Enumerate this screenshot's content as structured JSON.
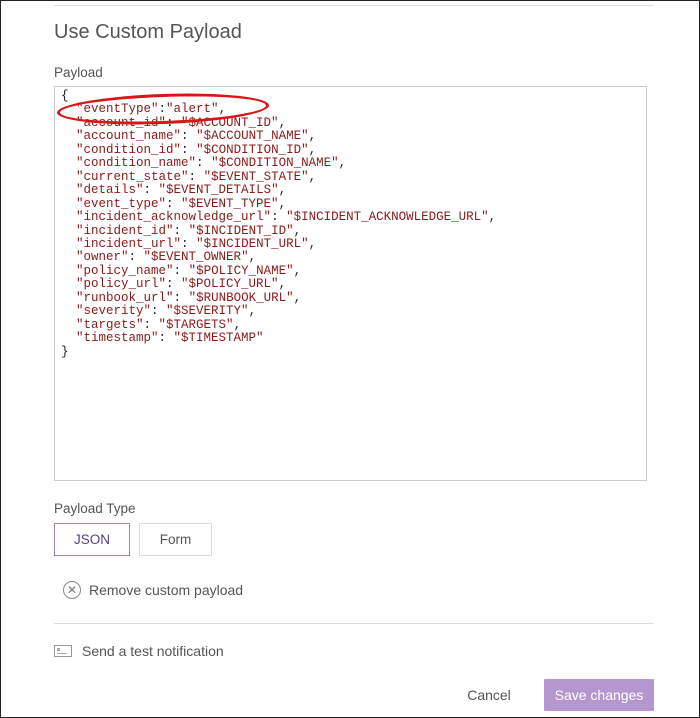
{
  "section": {
    "title": "Use Custom Payload"
  },
  "payload": {
    "label": "Payload",
    "open_brace": "{",
    "close_brace": "}",
    "entries": [
      {
        "key": "\"eventType\"",
        "sep": ":",
        "value": "\"alert\"",
        "comma": ","
      },
      {
        "key": "\"account_id\"",
        "sep": ": ",
        "value": "\"$ACCOUNT_ID\"",
        "comma": ","
      },
      {
        "key": "\"account_name\"",
        "sep": ": ",
        "value": "\"$ACCOUNT_NAME\"",
        "comma": ","
      },
      {
        "key": "\"condition_id\"",
        "sep": ": ",
        "value": "\"$CONDITION_ID\"",
        "comma": ","
      },
      {
        "key": "\"condition_name\"",
        "sep": ": ",
        "value": "\"$CONDITION_NAME\"",
        "comma": ","
      },
      {
        "key": "\"current_state\"",
        "sep": ": ",
        "value": "\"$EVENT_STATE\"",
        "comma": ","
      },
      {
        "key": "\"details\"",
        "sep": ": ",
        "value": "\"$EVENT_DETAILS\"",
        "comma": ","
      },
      {
        "key": "\"event_type\"",
        "sep": ": ",
        "value": "\"$EVENT_TYPE\"",
        "comma": ","
      },
      {
        "key": "\"incident_acknowledge_url\"",
        "sep": ": ",
        "value": "\"$INCIDENT_ACKNOWLEDGE_URL\"",
        "comma": ","
      },
      {
        "key": "\"incident_id\"",
        "sep": ": ",
        "value": "\"$INCIDENT_ID\"",
        "comma": ","
      },
      {
        "key": "\"incident_url\"",
        "sep": ": ",
        "value": "\"$INCIDENT_URL\"",
        "comma": ","
      },
      {
        "key": "\"owner\"",
        "sep": ": ",
        "value": "\"$EVENT_OWNER\"",
        "comma": ","
      },
      {
        "key": "\"policy_name\"",
        "sep": ": ",
        "value": "\"$POLICY_NAME\"",
        "comma": ","
      },
      {
        "key": "\"policy_url\"",
        "sep": ": ",
        "value": "\"$POLICY_URL\"",
        "comma": ","
      },
      {
        "key": "\"runbook_url\"",
        "sep": ": ",
        "value": "\"$RUNBOOK_URL\"",
        "comma": ","
      },
      {
        "key": "\"severity\"",
        "sep": ": ",
        "value": "\"$SEVERITY\"",
        "comma": ","
      },
      {
        "key": "\"targets\"",
        "sep": ": ",
        "value": "\"$TARGETS\"",
        "comma": ","
      },
      {
        "key": "\"timestamp\"",
        "sep": ": ",
        "value": "\"$TIMESTAMP\"",
        "comma": ""
      }
    ]
  },
  "payload_type": {
    "label": "Payload Type",
    "options": [
      "JSON",
      "Form"
    ],
    "selected": "JSON"
  },
  "remove_custom_payload": {
    "label": "Remove custom payload",
    "icon": "circle-x-icon"
  },
  "test_notification": {
    "label": "Send a test notification",
    "icon": "notification-card-icon"
  },
  "actions": {
    "cancel_label": "Cancel",
    "save_label": "Save changes"
  },
  "colors": {
    "accent": "#b596cf",
    "selected_border": "#9b86b6",
    "json_text": "#8b1a1a",
    "highlight": "#d81616"
  }
}
